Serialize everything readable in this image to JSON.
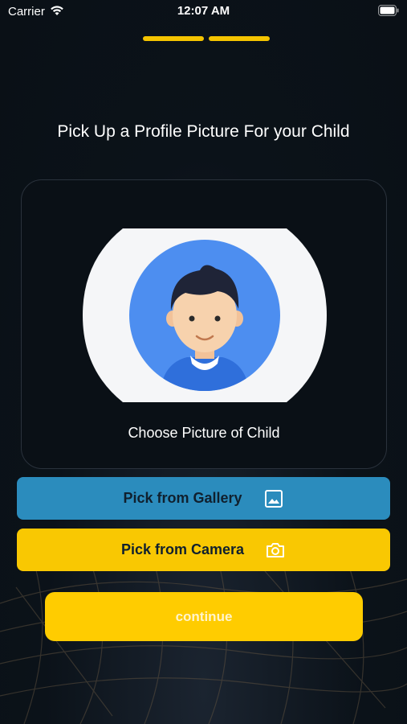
{
  "status_bar": {
    "carrier": "Carrier",
    "time": "12:07 AM",
    "icons": [
      "wifi-icon",
      "battery-icon"
    ]
  },
  "progress": {
    "steps_total": 2,
    "steps_completed": 2,
    "color": "#f5c400"
  },
  "title": "Pick Up a Profile Picture For your Child",
  "card": {
    "caption": "Choose Picture of Child",
    "avatar_icon": "child-avatar-icon"
  },
  "buttons": {
    "gallery": {
      "label": "Pick from Gallery",
      "icon": "image-icon",
      "color": "#2b8cbd"
    },
    "camera": {
      "label": "Pick from Camera",
      "icon": "camera-icon",
      "color": "#f9c802"
    },
    "continue": {
      "label": "continue",
      "color": "#ffcc00"
    }
  },
  "colors": {
    "background": "#0b1219",
    "accent_yellow": "#ffcc00",
    "accent_blue": "#2b8cbd"
  }
}
